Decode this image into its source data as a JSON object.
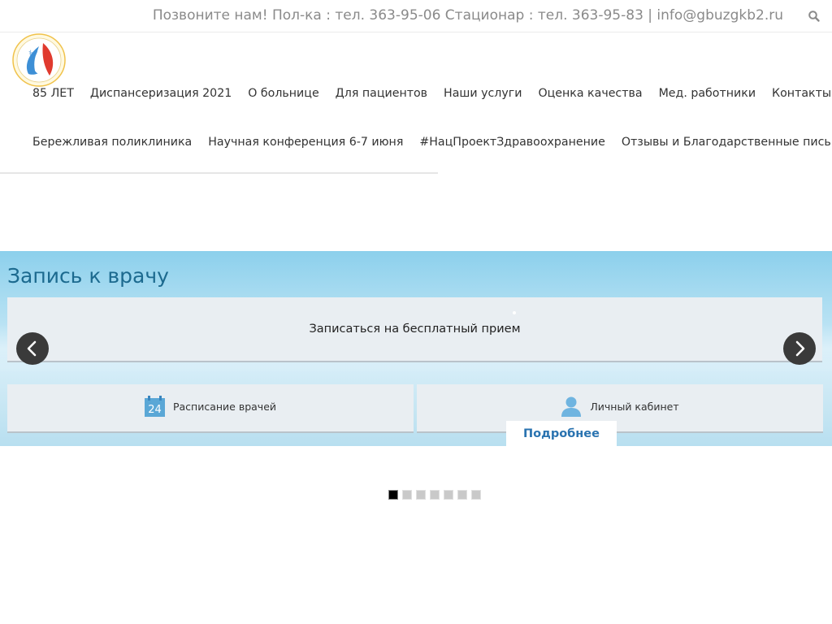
{
  "topbar": {
    "contact": "Позвоните нам! Пол-ка : тел. 363-95-06 Стационар : тел. 363-95-83 | info@gbuzgkb2.ru",
    "search_icon": "search-icon"
  },
  "nav": {
    "row1": [
      {
        "label": "85 ЛЕТ"
      },
      {
        "label": "Диспансеризация 2021"
      },
      {
        "label": "О больнице"
      },
      {
        "label": "Для пациентов"
      },
      {
        "label": "Наши услуги"
      },
      {
        "label": "Оценка качества"
      },
      {
        "label": "Мед. работники"
      },
      {
        "label": "Контакты"
      }
    ],
    "row2": [
      {
        "label": "Бережливая поликлиника"
      },
      {
        "label": "Научная конференция 6-7 июня"
      },
      {
        "label": "#НацПроектЗдравоохранение"
      },
      {
        "label": "Отзывы и Благодарственные письма"
      }
    ]
  },
  "banner": {
    "title": "Запись к врачу",
    "signup_label": "Записаться на бесплатный прием",
    "schedule_label": "Расписание врачей",
    "calendar_day": "24",
    "cabinet_label": "Личный кабинет",
    "more_label": "Подробнее"
  },
  "pager": {
    "count": 7,
    "active_index": 0
  },
  "colors": {
    "title": "#1c6a8f",
    "link": "#2a73b0",
    "icon_blue": "#5aa7d6",
    "arrow_bg": "#3a3a3a"
  }
}
